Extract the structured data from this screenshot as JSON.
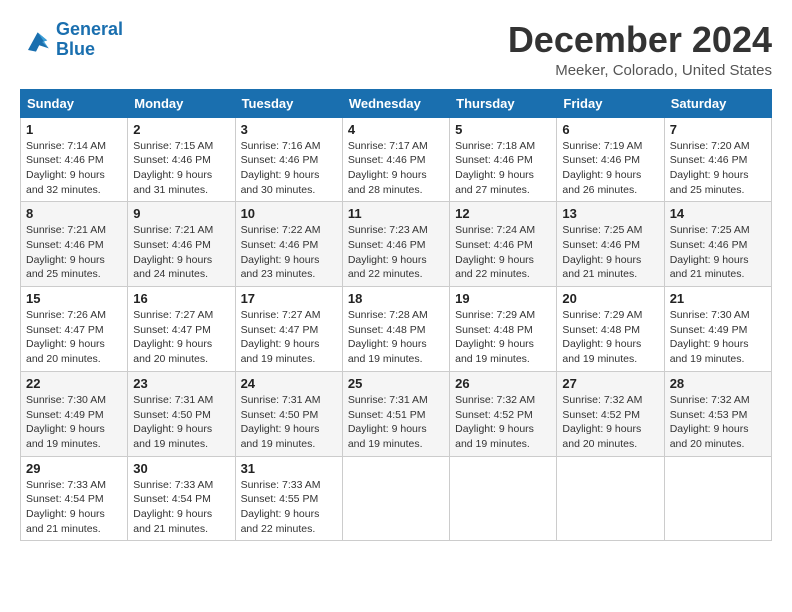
{
  "logo": {
    "line1": "General",
    "line2": "Blue"
  },
  "title": "December 2024",
  "location": "Meeker, Colorado, United States",
  "days_of_week": [
    "Sunday",
    "Monday",
    "Tuesday",
    "Wednesday",
    "Thursday",
    "Friday",
    "Saturday"
  ],
  "weeks": [
    [
      {
        "day": "1",
        "sunrise": "Sunrise: 7:14 AM",
        "sunset": "Sunset: 4:46 PM",
        "daylight": "Daylight: 9 hours and 32 minutes."
      },
      {
        "day": "2",
        "sunrise": "Sunrise: 7:15 AM",
        "sunset": "Sunset: 4:46 PM",
        "daylight": "Daylight: 9 hours and 31 minutes."
      },
      {
        "day": "3",
        "sunrise": "Sunrise: 7:16 AM",
        "sunset": "Sunset: 4:46 PM",
        "daylight": "Daylight: 9 hours and 30 minutes."
      },
      {
        "day": "4",
        "sunrise": "Sunrise: 7:17 AM",
        "sunset": "Sunset: 4:46 PM",
        "daylight": "Daylight: 9 hours and 28 minutes."
      },
      {
        "day": "5",
        "sunrise": "Sunrise: 7:18 AM",
        "sunset": "Sunset: 4:46 PM",
        "daylight": "Daylight: 9 hours and 27 minutes."
      },
      {
        "day": "6",
        "sunrise": "Sunrise: 7:19 AM",
        "sunset": "Sunset: 4:46 PM",
        "daylight": "Daylight: 9 hours and 26 minutes."
      },
      {
        "day": "7",
        "sunrise": "Sunrise: 7:20 AM",
        "sunset": "Sunset: 4:46 PM",
        "daylight": "Daylight: 9 hours and 25 minutes."
      }
    ],
    [
      {
        "day": "8",
        "sunrise": "Sunrise: 7:21 AM",
        "sunset": "Sunset: 4:46 PM",
        "daylight": "Daylight: 9 hours and 25 minutes."
      },
      {
        "day": "9",
        "sunrise": "Sunrise: 7:21 AM",
        "sunset": "Sunset: 4:46 PM",
        "daylight": "Daylight: 9 hours and 24 minutes."
      },
      {
        "day": "10",
        "sunrise": "Sunrise: 7:22 AM",
        "sunset": "Sunset: 4:46 PM",
        "daylight": "Daylight: 9 hours and 23 minutes."
      },
      {
        "day": "11",
        "sunrise": "Sunrise: 7:23 AM",
        "sunset": "Sunset: 4:46 PM",
        "daylight": "Daylight: 9 hours and 22 minutes."
      },
      {
        "day": "12",
        "sunrise": "Sunrise: 7:24 AM",
        "sunset": "Sunset: 4:46 PM",
        "daylight": "Daylight: 9 hours and 22 minutes."
      },
      {
        "day": "13",
        "sunrise": "Sunrise: 7:25 AM",
        "sunset": "Sunset: 4:46 PM",
        "daylight": "Daylight: 9 hours and 21 minutes."
      },
      {
        "day": "14",
        "sunrise": "Sunrise: 7:25 AM",
        "sunset": "Sunset: 4:46 PM",
        "daylight": "Daylight: 9 hours and 21 minutes."
      }
    ],
    [
      {
        "day": "15",
        "sunrise": "Sunrise: 7:26 AM",
        "sunset": "Sunset: 4:47 PM",
        "daylight": "Daylight: 9 hours and 20 minutes."
      },
      {
        "day": "16",
        "sunrise": "Sunrise: 7:27 AM",
        "sunset": "Sunset: 4:47 PM",
        "daylight": "Daylight: 9 hours and 20 minutes."
      },
      {
        "day": "17",
        "sunrise": "Sunrise: 7:27 AM",
        "sunset": "Sunset: 4:47 PM",
        "daylight": "Daylight: 9 hours and 19 minutes."
      },
      {
        "day": "18",
        "sunrise": "Sunrise: 7:28 AM",
        "sunset": "Sunset: 4:48 PM",
        "daylight": "Daylight: 9 hours and 19 minutes."
      },
      {
        "day": "19",
        "sunrise": "Sunrise: 7:29 AM",
        "sunset": "Sunset: 4:48 PM",
        "daylight": "Daylight: 9 hours and 19 minutes."
      },
      {
        "day": "20",
        "sunrise": "Sunrise: 7:29 AM",
        "sunset": "Sunset: 4:48 PM",
        "daylight": "Daylight: 9 hours and 19 minutes."
      },
      {
        "day": "21",
        "sunrise": "Sunrise: 7:30 AM",
        "sunset": "Sunset: 4:49 PM",
        "daylight": "Daylight: 9 hours and 19 minutes."
      }
    ],
    [
      {
        "day": "22",
        "sunrise": "Sunrise: 7:30 AM",
        "sunset": "Sunset: 4:49 PM",
        "daylight": "Daylight: 9 hours and 19 minutes."
      },
      {
        "day": "23",
        "sunrise": "Sunrise: 7:31 AM",
        "sunset": "Sunset: 4:50 PM",
        "daylight": "Daylight: 9 hours and 19 minutes."
      },
      {
        "day": "24",
        "sunrise": "Sunrise: 7:31 AM",
        "sunset": "Sunset: 4:50 PM",
        "daylight": "Daylight: 9 hours and 19 minutes."
      },
      {
        "day": "25",
        "sunrise": "Sunrise: 7:31 AM",
        "sunset": "Sunset: 4:51 PM",
        "daylight": "Daylight: 9 hours and 19 minutes."
      },
      {
        "day": "26",
        "sunrise": "Sunrise: 7:32 AM",
        "sunset": "Sunset: 4:52 PM",
        "daylight": "Daylight: 9 hours and 19 minutes."
      },
      {
        "day": "27",
        "sunrise": "Sunrise: 7:32 AM",
        "sunset": "Sunset: 4:52 PM",
        "daylight": "Daylight: 9 hours and 20 minutes."
      },
      {
        "day": "28",
        "sunrise": "Sunrise: 7:32 AM",
        "sunset": "Sunset: 4:53 PM",
        "daylight": "Daylight: 9 hours and 20 minutes."
      }
    ],
    [
      {
        "day": "29",
        "sunrise": "Sunrise: 7:33 AM",
        "sunset": "Sunset: 4:54 PM",
        "daylight": "Daylight: 9 hours and 21 minutes."
      },
      {
        "day": "30",
        "sunrise": "Sunrise: 7:33 AM",
        "sunset": "Sunset: 4:54 PM",
        "daylight": "Daylight: 9 hours and 21 minutes."
      },
      {
        "day": "31",
        "sunrise": "Sunrise: 7:33 AM",
        "sunset": "Sunset: 4:55 PM",
        "daylight": "Daylight: 9 hours and 22 minutes."
      },
      null,
      null,
      null,
      null
    ]
  ]
}
